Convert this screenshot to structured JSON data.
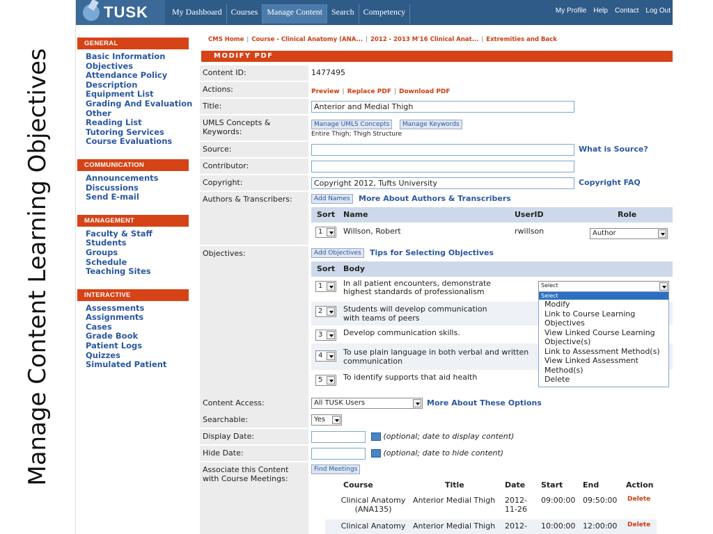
{
  "slide_title": "Manage Content Learning Objectives",
  "app": {
    "logo": "TUSK"
  },
  "topnav": {
    "items": [
      "My Dashboard",
      "Courses",
      "Manage Content",
      "Search",
      "Competency"
    ],
    "right": [
      "My Profile",
      "Help",
      "Contact",
      "Log Out"
    ]
  },
  "sidebar": {
    "general": {
      "head": "GENERAL",
      "items": [
        "Basic Information",
        "Objectives",
        "Attendance Policy",
        "Description",
        "Equipment List",
        "Grading And Evaluation",
        "Other",
        "Reading List",
        "Tutoring Services",
        "Course Evaluations"
      ]
    },
    "communication": {
      "head": "COMMUNICATION",
      "items": [
        "Announcements",
        "Discussions",
        "Send E-mail"
      ]
    },
    "management": {
      "head": "MANAGEMENT",
      "items": [
        "Faculty & Staff",
        "Students",
        "Groups",
        "Schedule",
        "Teaching Sites"
      ]
    },
    "interactive": {
      "head": "INTERACTIVE",
      "items": [
        "Assessments",
        "Assignments",
        "Cases",
        "Grade Book",
        "Patient Logs",
        "Quizzes",
        "Simulated Patient"
      ]
    }
  },
  "breadcrumb": [
    "CMS Home",
    "Course - Clinical Anatomy (ANA...",
    "2012 - 2013 M'16 Clinical Anat...",
    "Extremities and Back"
  ],
  "page_title": "MODIFY PDF",
  "form": {
    "content_id_label": "Content ID:",
    "content_id": "1477495",
    "actions_label": "Actions:",
    "actions": [
      "Preview",
      "Replace PDF",
      "Download PDF"
    ],
    "title_label": "Title:",
    "title_value": "Anterior and Medial Thigh",
    "umls_label": "UMLS Concepts & Keywords:",
    "umls_btn1": "Manage UMLS Concepts",
    "umls_btn2": "Manage Keywords",
    "umls_text": "Entire Thigh; Thigh Structure",
    "source_label": "Source:",
    "source_link": "What is Source?",
    "contributor_label": "Contributor:",
    "copyright_label": "Copyright:",
    "copyright_value": "Copyright 2012, Tufts University",
    "copyright_link": "Copyright FAQ",
    "authors_label": "Authors & Transcribers:",
    "add_names": "Add Names",
    "authors_link": "More About Authors & Transcribers",
    "authors_head": [
      "Sort",
      "Name",
      "UserID",
      "Role"
    ],
    "author": {
      "sort": "1",
      "name": "Willson, Robert",
      "userid": "rwillson",
      "role": "Author"
    },
    "objectives_label": "Objectives:",
    "add_objectives": "Add Objectives",
    "objectives_link": "Tips for Selecting Objectives",
    "obj_head": [
      "Sort",
      "Body"
    ],
    "objectives": [
      {
        "sort": "1",
        "body": "In all patient encounters, demonstrate highest standards of professionalism"
      },
      {
        "sort": "2",
        "body": "Students will develop communication with teams of peers"
      },
      {
        "sort": "3",
        "body": "Develop communication skills."
      },
      {
        "sort": "4",
        "body": "To use plain language in both verbal and written communication"
      },
      {
        "sort": "5",
        "body": "To identify supports that aid health"
      }
    ],
    "select_value": "Select",
    "menu": {
      "header": "Select",
      "items": [
        "Modify",
        "Link to Course Learning Objectives",
        "View Linked Course Learning Objective(s)",
        "Link to Assessment Method(s)",
        "View Linked Assessment Method(s)",
        "Delete"
      ]
    },
    "access_label": "Content Access:",
    "access_value": "All TUSK Users",
    "access_link": "More About These Options",
    "searchable_label": "Searchable:",
    "searchable_value": "Yes",
    "display_label": "Display Date:",
    "display_hint": "(optional; date to display content)",
    "hide_label": "Hide Date:",
    "hide_hint": "(optional; date to hide content)",
    "assoc_label": "Associate this Content with Course Meetings:",
    "find_meetings": "Find Meetings",
    "meet_head": [
      "Course",
      "Title",
      "Date",
      "Start",
      "End",
      "Action"
    ],
    "meetings": [
      {
        "course": "Clinical Anatomy (ANA135)",
        "title": "Anterior Medial Thigh",
        "date": "2012-11-26",
        "start": "09:00:00",
        "end": "09:50:00",
        "action": "Delete"
      },
      {
        "course": "Clinical Anatomy",
        "title": "Anterior Medial Thigh",
        "date": "2012-",
        "start": "10:00:00",
        "end": "12:00:00",
        "action": "Delete"
      }
    ]
  }
}
